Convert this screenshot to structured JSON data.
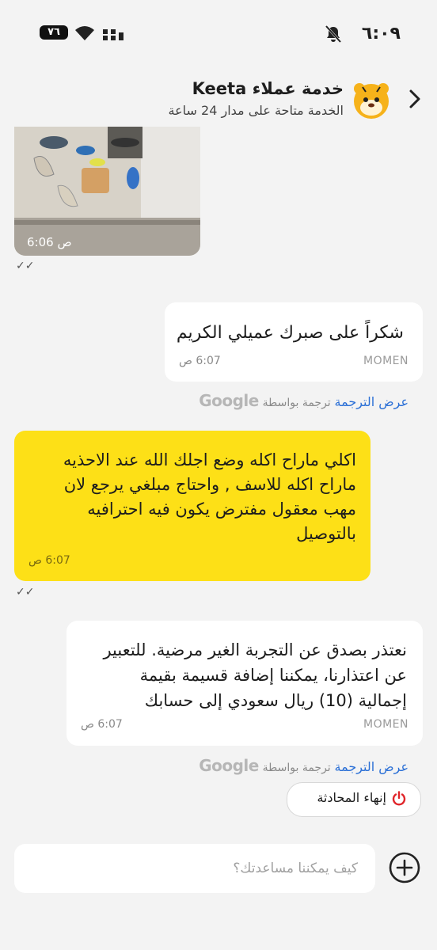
{
  "status_bar": {
    "time": "٦:٠٩",
    "battery": "٧٦"
  },
  "header": {
    "title": "خدمة عملاء Keeta",
    "subtitle": "الخدمة متاحة على مدار 24 ساعة"
  },
  "messages": [
    {
      "type": "image",
      "time": "6:06 ص",
      "ticks": "✓✓"
    },
    {
      "type": "agent",
      "lines": [
        "شكراً على صبرك عميلي الكريم"
      ],
      "sender": "MOMEN",
      "time": "6:07 ص",
      "show_translation": "عرض الترجمة",
      "translated_by": "ترجمة بواسطة",
      "google": "Google"
    },
    {
      "type": "user",
      "lines": [
        "اكلي ماراح اكله وضع اجلك الله عند الاحذيه",
        "ماراح اكله للاسف , واحتاج مبلغي يرجع لان",
        "مهب معقول مفترض يكون فيه احترافيه",
        "بالتوصيل"
      ],
      "time": "6:07 ص",
      "ticks": "✓✓"
    },
    {
      "type": "agent",
      "lines": [
        "نعتذر بصدق عن التجربة الغير مرضية. للتعبير",
        "عن اعتذارنا، يمكننا إضافة قسيمة بقيمة",
        "إجمالية (10) ريال سعودي إلى حسابك"
      ],
      "sender": "MOMEN",
      "time": "6:07 ص",
      "show_translation": "عرض الترجمة",
      "translated_by": "ترجمة بواسطة",
      "google": "Google"
    }
  ],
  "end_chat_label": "إنهاء المحادثة",
  "input": {
    "placeholder": "كيف يمكننا مساعدتك؟"
  },
  "icons": {
    "back": "chevron-right-icon",
    "avatar": "tiger-mascot-icon",
    "end": "power-icon",
    "add": "plus-circle-icon"
  },
  "colors": {
    "user_bubble": "#fde017",
    "link": "#2a6fd6",
    "power": "#e0262b"
  }
}
